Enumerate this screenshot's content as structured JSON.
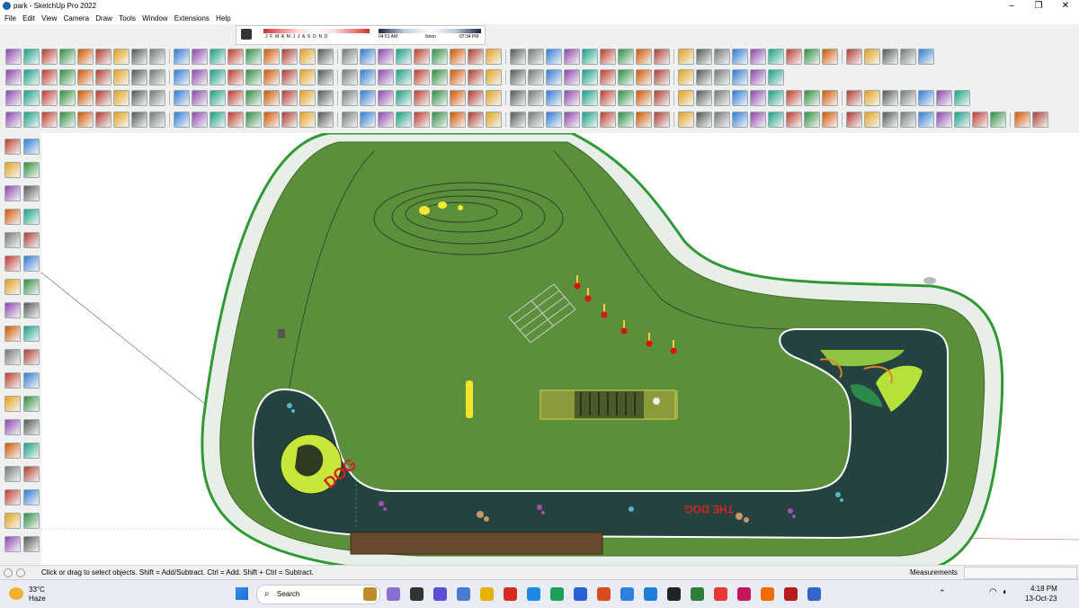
{
  "window": {
    "title": "park - SketchUp Pro 2022",
    "min": "–",
    "max": "❐",
    "close": "✕"
  },
  "menu": [
    "File",
    "Edit",
    "View",
    "Camera",
    "Draw",
    "Tools",
    "Window",
    "Extensions",
    "Help"
  ],
  "shadow": {
    "months": "J  F  M  A  M  J  J  A  S  O  N  D",
    "start": "04:51 AM",
    "noon": "Noon",
    "end": "07:34 PM"
  },
  "model": {
    "text": "THE DOG",
    "logo_text": "DOG"
  },
  "status": {
    "hint": "Click or drag to select objects. Shift = Add/Subtract. Ctrl = Add. Shift + Ctrl = Subtract.",
    "measurements_label": "Measurements"
  },
  "taskbar": {
    "weather_temp": "33°C",
    "weather_cond": "Haze",
    "search_label": "Search",
    "time": "4:18 PM",
    "date": "13-Oct-23"
  },
  "colors": {
    "grass": "#5c8f3c",
    "track": "#24423f",
    "fence": "#2f9a35",
    "lime": "#c7e83a"
  }
}
